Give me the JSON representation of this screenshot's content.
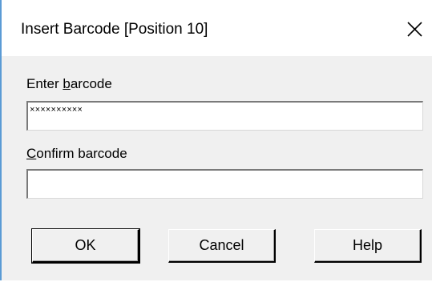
{
  "dialog": {
    "title": "Insert Barcode [Position 10]",
    "close_icon": "close-icon"
  },
  "barcode": {
    "label_before": "Enter ",
    "label_mnemonic": "b",
    "label_after": "arcode",
    "value": "××××××××××"
  },
  "confirm": {
    "label_mnemonic": "C",
    "label_after": "onfirm barcode",
    "value": ""
  },
  "buttons": {
    "ok": "OK",
    "cancel": "Cancel",
    "help": "Help"
  },
  "colors": {
    "face": "#f0f0f0",
    "title_bg": "#ffffff",
    "accent_edge": "#5b9bd5"
  }
}
